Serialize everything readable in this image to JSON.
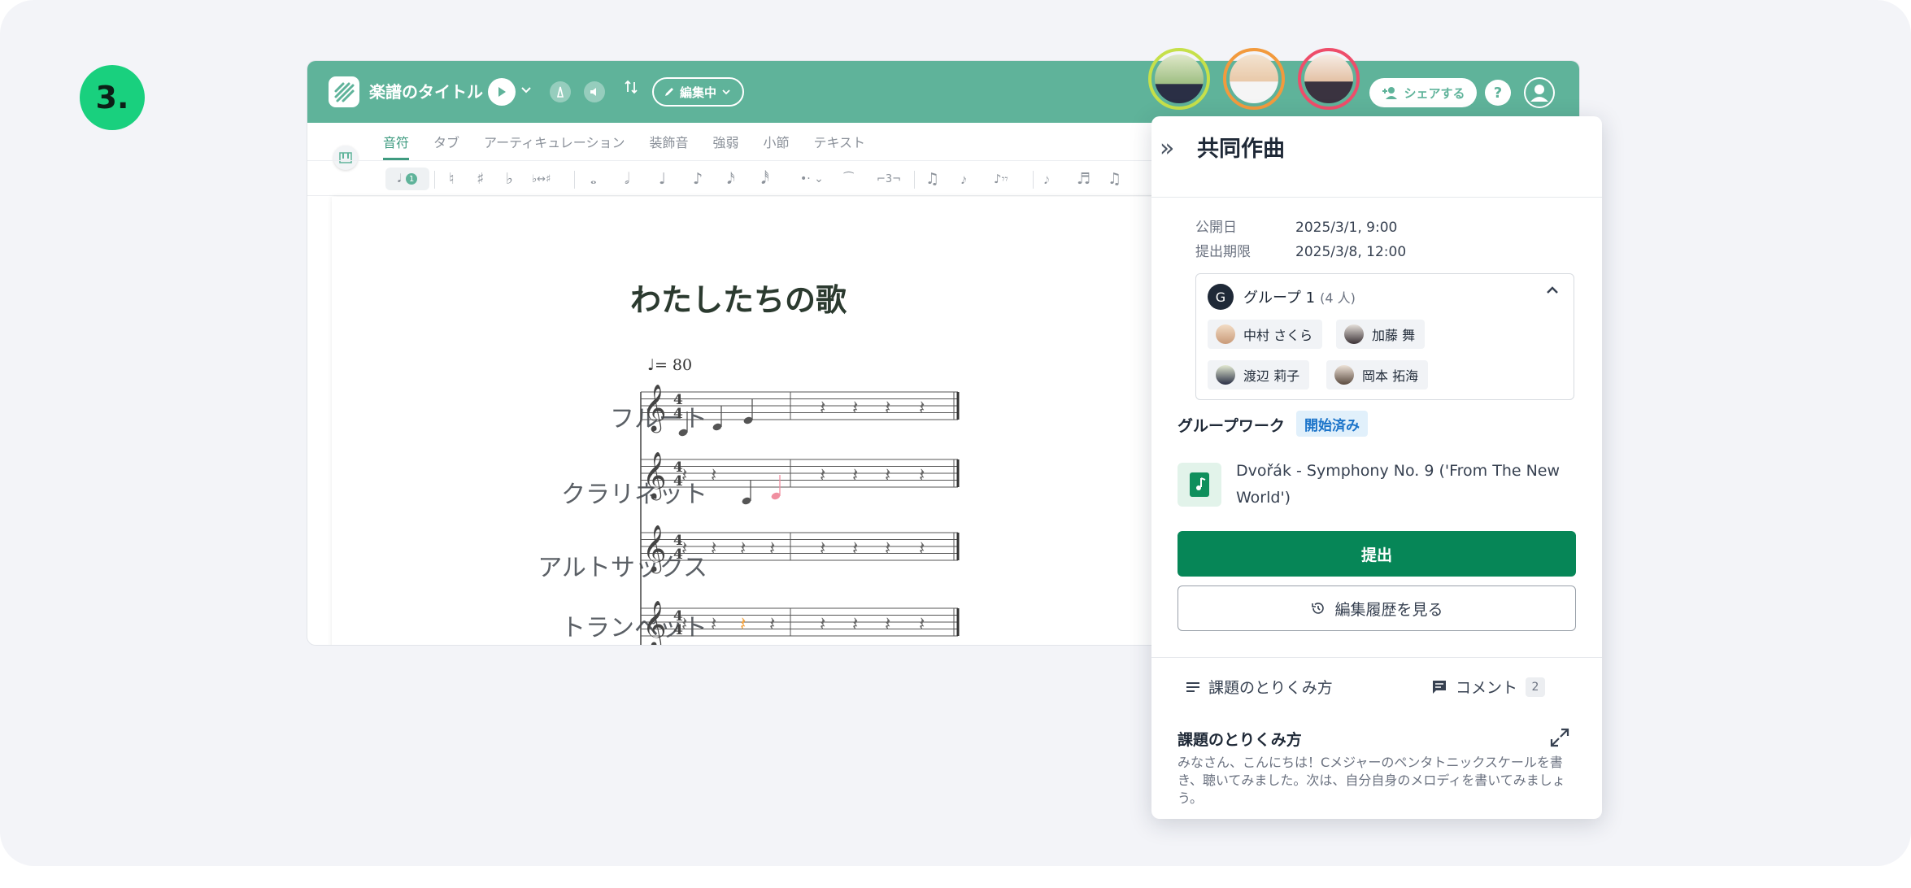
{
  "step": {
    "label": "3."
  },
  "app": {
    "title": "楽譜のタイトル",
    "mode_label": "編集中",
    "share_label": "シェアする",
    "help_label": "?",
    "tabs": [
      "音符",
      "タブ",
      "アーティキュレーション",
      "装飾音",
      "強弱",
      "小節",
      "テキスト"
    ],
    "active_tab": 0,
    "note_value_badge": "1",
    "accent_color": "#5fb39a"
  },
  "score": {
    "title": "わたしたちの歌",
    "tempo": "♩= 80",
    "instruments": [
      "フルート",
      "クラリネット",
      "アルトサックス",
      "トランペット"
    ],
    "time_signature": "4/4"
  },
  "panel": {
    "title": "共同作曲",
    "published_label": "公開日",
    "published_value": "2025/3/1, 9:00",
    "deadline_label": "提出期限",
    "deadline_value": "2025/3/8, 12:00",
    "group": {
      "initial": "G",
      "name": "グループ 1",
      "count": "(4 人)",
      "members": [
        "中村 さくら",
        "加藤 舞",
        "渡辺 莉子",
        "岡本 拓海"
      ]
    },
    "groupwork_label": "グループワーク",
    "status_badge": "開始済み",
    "file_name": "Dvořák - Symphony No. 9 ('From The New World')",
    "submit_label": "提出",
    "history_label": "編集履歴を見る",
    "tab_howto_label": "課題のとりくみ方",
    "tab_comment_label": "コメント",
    "comment_count": "2",
    "howto_title": "課題のとりくみ方",
    "howto_text": "みなさん、こんにちは！Cメジャーのペンタトニックスケールを書き、聴いてみました。次は、自分自身のメロディを書いてみましょう。",
    "submit_color": "#068657",
    "badge_color": "#1a73c9"
  }
}
